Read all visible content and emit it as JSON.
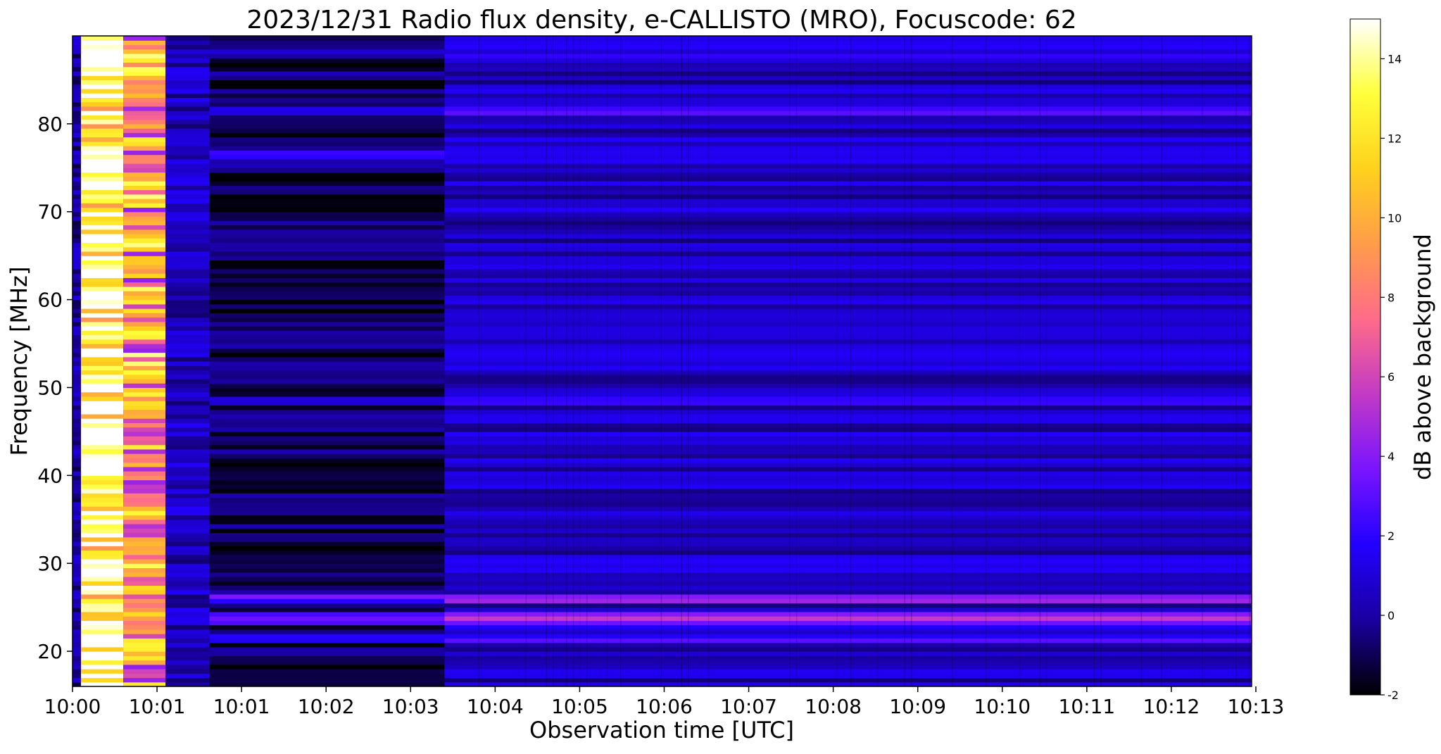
{
  "chart_data": {
    "type": "heatmap",
    "title": "2023/12/31  Radio flux density, e-CALLISTO (MRO), Focuscode: 62",
    "xlabel": "Observation time [UTC]",
    "ylabel": "Frequency [MHz]",
    "colorbar_label": "dB above background",
    "xlim": [
      0,
      13.95
    ],
    "ylim": [
      16,
      90
    ],
    "x_ticks": [
      {
        "value": 0,
        "label": "10:00"
      },
      {
        "value": 1,
        "label": "10:01"
      },
      {
        "value": 2,
        "label": "10:01"
      },
      {
        "value": 3,
        "label": "10:02"
      },
      {
        "value": 4,
        "label": "10:03"
      },
      {
        "value": 5,
        "label": "10:04"
      },
      {
        "value": 6,
        "label": "10:05"
      },
      {
        "value": 7,
        "label": "10:06"
      },
      {
        "value": 8,
        "label": "10:07"
      },
      {
        "value": 9,
        "label": "10:08"
      },
      {
        "value": 10,
        "label": "10:09"
      },
      {
        "value": 11,
        "label": "10:10"
      },
      {
        "value": 12,
        "label": "10:11"
      },
      {
        "value": 13,
        "label": "10:12"
      },
      {
        "value": 14,
        "label": "10:13"
      }
    ],
    "y_ticks": [
      20,
      30,
      40,
      50,
      60,
      70,
      80
    ],
    "colorbar": {
      "range": [
        -2,
        15
      ],
      "ticks": [
        -2,
        0,
        2,
        4,
        6,
        8,
        10,
        12,
        14
      ],
      "colormap": "gnuplot2",
      "stops": [
        "#000000",
        "#1a00a0",
        "#2200ff",
        "#7a14ff",
        "#c23ac5",
        "#ff6b8a",
        "#ff9c4a",
        "#ffd11c",
        "#ffff3a",
        "#ffffff"
      ]
    },
    "segments": [
      {
        "x0": 0.0,
        "x1": 0.1,
        "level": 0.0,
        "note": "dark edge"
      },
      {
        "x0": 0.1,
        "x1": 0.6,
        "level": 14.0
      },
      {
        "x0": 0.6,
        "x1": 1.1,
        "level": 9.0
      },
      {
        "x0": 1.1,
        "x1": 1.62,
        "level": 0.5
      },
      {
        "x0": 1.62,
        "x1": 4.4,
        "level": -0.8
      },
      {
        "x0": 4.4,
        "x1": 13.95,
        "level": 0.6
      }
    ],
    "bands": [
      {
        "y0": 23.0,
        "y1": 24.2,
        "level": 4.0
      },
      {
        "y0": 21.0,
        "y1": 22.0,
        "level": 2.0
      },
      {
        "y0": 25.3,
        "y1": 26.3,
        "level": 3.0
      },
      {
        "y0": 47.8,
        "y1": 48.6,
        "level": 1.6
      },
      {
        "y0": 76.0,
        "y1": 77.0,
        "level": 1.6
      },
      {
        "y0": 81.0,
        "y1": 82.0,
        "level": 1.4
      },
      {
        "y0": 87.5,
        "y1": 88.5,
        "level": 1.5
      }
    ]
  }
}
